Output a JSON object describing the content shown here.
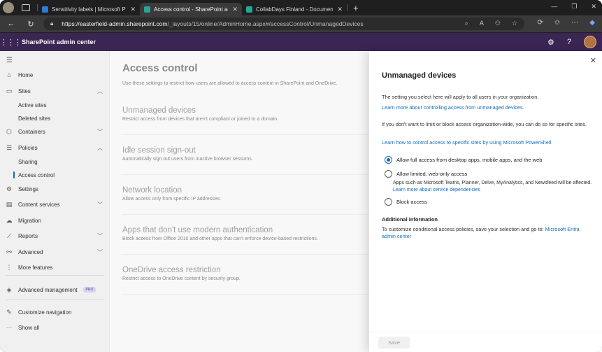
{
  "browser": {
    "tabs": [
      {
        "title": "Sensitivity labels | Microsoft Purv",
        "active": false,
        "favicon_color": "#2f7bd8"
      },
      {
        "title": "Access control - SharePoint admi",
        "active": true,
        "favicon_color": "#2aa39a"
      },
      {
        "title": "CollabDays Finland - Documents",
        "active": false,
        "favicon_color": "#2aa39a"
      }
    ],
    "url_host": "https://easterfield-admin.sharepoint.com",
    "url_path": "/_layouts/15/online/AdminHome.aspx#/accessControl/UnmanagedDevices"
  },
  "suite": {
    "app_name": "SharePoint admin center"
  },
  "nav": {
    "home": "Home",
    "sites": "Sites",
    "active_sites": "Active sites",
    "deleted_sites": "Deleted sites",
    "containers": "Containers",
    "policies": "Policies",
    "sharing": "Sharing",
    "access_control": "Access control",
    "settings": "Settings",
    "content_services": "Content services",
    "migration": "Migration",
    "reports": "Reports",
    "advanced": "Advanced",
    "more_features": "More features",
    "advanced_management": "Advanced management",
    "pro_badge": "PRO",
    "customize_navigation": "Customize navigation",
    "show_all": "Show all"
  },
  "main": {
    "title": "Access control",
    "description": "Use these settings to restrict how users are allowed to access content in SharePoint and OneDrive.",
    "settings": [
      {
        "title": "Unmanaged devices",
        "desc": "Restrict access from devices that aren't compliant or joined to a domain."
      },
      {
        "title": "Idle session sign-out",
        "desc": "Automatically sign out users from inactive browser sessions."
      },
      {
        "title": "Network location",
        "desc": "Allow access only from specific IP addresses."
      },
      {
        "title": "Apps that don't use modern authentication",
        "desc": "Block access from Office 2010 and other apps that can't enforce device-based restrictions."
      },
      {
        "title": "OneDrive access restriction",
        "desc": "Restrict access to OneDrive content by security group."
      }
    ]
  },
  "panel": {
    "title": "Unmanaged devices",
    "intro": "The setting you select here will apply to all users in your organization.",
    "link1": "Learn more about controlling access from unmanaged devices.",
    "para2": "If you don't want to limit or block access organization-wide, you can do so for specific sites.",
    "link2": "Learn how to control access to specific sites by using Microsoft PowerShell",
    "options": [
      {
        "label": "Allow full access from desktop apps, mobile apps, and the web",
        "checked": true
      },
      {
        "label": "Allow limited, web-only access",
        "checked": false
      },
      {
        "label": "Block access",
        "checked": false
      }
    ],
    "limited_desc": "Apps such as Microsoft Teams, Planner, Delve, MyAnalytics, and Newsfeed will be affected.",
    "limited_link": "Learn more about service dependencies",
    "additional_title": "Additional information",
    "additional_text": "To customize conditional access policies, save your selection and go to:",
    "additional_link": "Microsoft Entra admin center",
    "save_label": "Save"
  }
}
